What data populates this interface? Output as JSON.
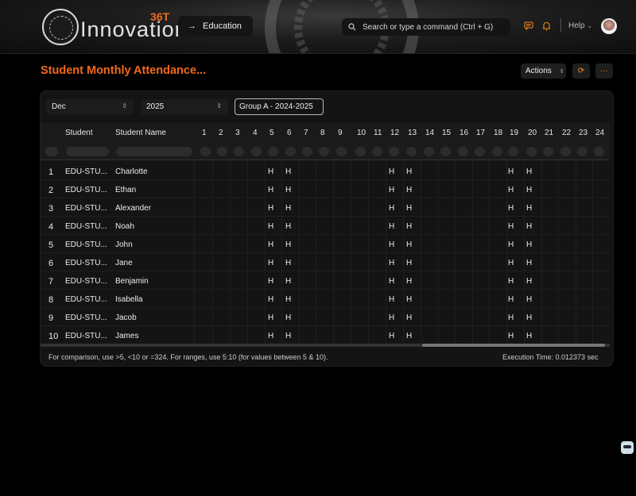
{
  "header": {
    "logo_text": "Innovation",
    "logo_sup": "36T",
    "breadcrumb": "Education",
    "search_placeholder": "Search or type a command (Ctrl + G)",
    "help_label": "Help"
  },
  "page": {
    "title": "Student Monthly Attendance...",
    "actions_label": "Actions"
  },
  "filters": {
    "month": "Dec",
    "year": "2025",
    "group": "Group A - 2024-2025"
  },
  "table": {
    "col_student": "Student",
    "col_student_name": "Student Name",
    "days": [
      "1",
      "2",
      "3",
      "4",
      "5",
      "6",
      "7",
      "8",
      "9",
      "10",
      "11",
      "12",
      "13",
      "14",
      "15",
      "16",
      "17",
      "18",
      "19",
      "20",
      "21",
      "22",
      "23",
      "24"
    ],
    "holiday_days": [
      5,
      6,
      12,
      13,
      19,
      20
    ],
    "holiday_mark": "H",
    "rows": [
      {
        "n": "1",
        "id": "EDU-STU...",
        "name": "Charlotte"
      },
      {
        "n": "2",
        "id": "EDU-STU...",
        "name": "Ethan"
      },
      {
        "n": "3",
        "id": "EDU-STU...",
        "name": "Alexander"
      },
      {
        "n": "4",
        "id": "EDU-STU...",
        "name": "Noah"
      },
      {
        "n": "5",
        "id": "EDU-STU...",
        "name": "John"
      },
      {
        "n": "6",
        "id": "EDU-STU...",
        "name": "Jane"
      },
      {
        "n": "7",
        "id": "EDU-STU...",
        "name": "Benjamin"
      },
      {
        "n": "8",
        "id": "EDU-STU...",
        "name": "Isabella"
      },
      {
        "n": "9",
        "id": "EDU-STU...",
        "name": "Jacob"
      },
      {
        "n": "10",
        "id": "EDU-STU...",
        "name": "James"
      }
    ]
  },
  "footer": {
    "hint": "For comparison, use >5, <10 or =324. For ranges, use 5:10 (for values between 5 & 10).",
    "exec_time": "Execution Time: 0.012373 sec"
  },
  "colors": {
    "accent": "#f26a1b",
    "background": "#000000",
    "panel": "#141414"
  }
}
